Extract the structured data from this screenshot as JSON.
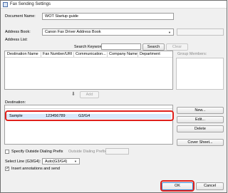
{
  "window": {
    "title": "Fax Sending Settings"
  },
  "document_name": {
    "label": "Document Name:",
    "value": "WOT Startup guide"
  },
  "address_book": {
    "label": "Address Book:",
    "value": "Canon Fax Driver Address Book"
  },
  "address_list": {
    "label": "Address List:",
    "search_label": "Search Keywords:",
    "search_button": "Search",
    "clear_button": "Clear",
    "columns": [
      "Destination Name",
      "Fax Number/URI",
      "Communication...",
      "Company Name",
      "Department"
    ]
  },
  "group_members": {
    "label": "Group Members:"
  },
  "add_button": "Add",
  "destination": {
    "label": "Destination:",
    "row": {
      "name": "Sample",
      "number": "123456789",
      "mode": "G3/G4"
    }
  },
  "side_buttons": {
    "new": "New...",
    "edit": "Edit...",
    "delete": "Delete",
    "cover_sheet": "Cover Sheet..."
  },
  "outside_dialing": {
    "checkbox_label": "Specify Outside Dialing Prefix",
    "prefix_label": "Outside Dialing Prefix:",
    "checked": false
  },
  "select_line": {
    "label": "Select Line (G3/G4):",
    "value": "Auto(G3/G4)"
  },
  "insert_annotations": {
    "label": "Insert annotations and send",
    "checked": true
  },
  "footer": {
    "ok": "OK",
    "cancel": "Cancel"
  },
  "colors": {
    "highlight": "#e0201b",
    "selection": "#d7e8fa",
    "focus": "#3b8ad6"
  }
}
